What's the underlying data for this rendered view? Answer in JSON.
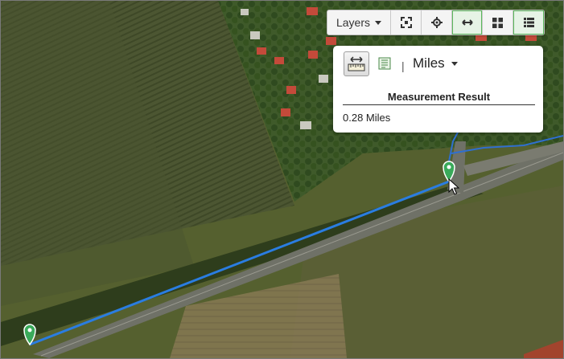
{
  "toolbar": {
    "layers_label": "Layers",
    "buttons": [
      "fullscreen-icon",
      "locate-icon",
      "measure-icon",
      "grid-icon",
      "list-icon"
    ]
  },
  "measure_panel": {
    "unit": "Miles",
    "result_title": "Measurement Result",
    "result_value": "0.28 Miles"
  },
  "colors": {
    "route_line": "#2a7de1",
    "marker": "#3aaa5a",
    "road_blue": "#2f6fcf"
  }
}
